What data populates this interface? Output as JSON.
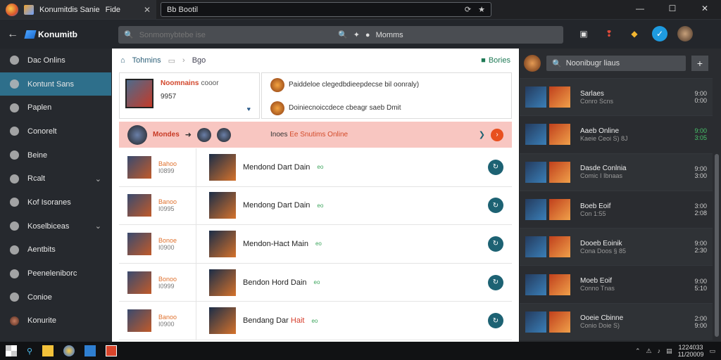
{
  "browser": {
    "tab_title": "Konumitdis Sanie",
    "tab2_title": "Fide",
    "url": "Bb Bootil"
  },
  "app": {
    "logo": "Konumitb",
    "search_placeholder": "Sonmomybtebe ise",
    "search_mid": "Momms"
  },
  "sidebar": {
    "items": [
      {
        "label": "Dac Onlins"
      },
      {
        "label": "Kontunt Sans"
      },
      {
        "label": "Paplen"
      },
      {
        "label": "Conorelt"
      },
      {
        "label": "Beine"
      },
      {
        "label": "Rcalt"
      },
      {
        "label": "Kof Isoranes"
      },
      {
        "label": "Koselbiceas"
      },
      {
        "label": "Aentbits"
      },
      {
        "label": "Peeneleniborc"
      },
      {
        "label": "Conioe"
      },
      {
        "label": "Konurite"
      }
    ]
  },
  "main": {
    "crumb_root": "Tohmins",
    "crumb_child": "Bgo",
    "crumb_right": "Bories",
    "card": {
      "name": "Noomnains",
      "sub": "cooor",
      "count": "9957"
    },
    "notices": [
      {
        "text": "Paiddeloe clegedbdieepdecse bil oonraly)"
      },
      {
        "text": "Doiniecnoiccdece cbeagr saeb Dmit"
      }
    ],
    "banner": {
      "name": "Mondes",
      "text_a": "Inoes",
      "text_b": "Ee Snutims Online"
    },
    "rows": [
      {
        "l1": "Bahoo",
        "l2": "I0899",
        "title": "Mendond Dart Dain",
        "red": "",
        "tag": "eo"
      },
      {
        "l1": "Banoo",
        "l2": "I0995",
        "title": "Mendong Dart Dain",
        "red": "",
        "tag": "eo"
      },
      {
        "l1": "Bonoe",
        "l2": "I0900",
        "title": "Mendon-Hact Main",
        "red": "",
        "tag": "eo"
      },
      {
        "l1": "Bonoo",
        "l2": "I0999",
        "title": "Bendon Hord Dain",
        "red": "",
        "tag": "eo"
      },
      {
        "l1": "Banoo",
        "l2": "I0900",
        "title": "Bendang Dar ",
        "red": "Hait",
        "tag": "eo"
      }
    ]
  },
  "right_panel": {
    "search": "Noonibugr liaus",
    "items": [
      {
        "name": "Sarlaes",
        "sub": "Conro Scns",
        "val1": "9:00",
        "val2": "0:00",
        "green": false
      },
      {
        "name": "Aaeb Online",
        "sub": "Kaeie Ceoi S) 8J",
        "val1": "9:00",
        "val2": "3:05",
        "green": true
      },
      {
        "name": "Dasde Conlnia",
        "sub": "Comic I Ibnaas",
        "val1": "9:00",
        "val2": "3:00",
        "green": false
      },
      {
        "name": "Boeb Eoif",
        "sub": "Con 1:55",
        "val1": "3:00",
        "val2": "2:08",
        "green": false
      },
      {
        "name": "Dooeb Eoinik",
        "sub": "Cona Doos § 85",
        "val1": "9:00",
        "val2": "2:30",
        "green": false
      },
      {
        "name": "Moeb Eoif",
        "sub": "Conno Tnas",
        "val1": "9:00",
        "val2": "5:10",
        "green": false
      },
      {
        "name": "Ooeie Cbinne",
        "sub": "Conio Doie S)",
        "val1": "2:00",
        "val2": "9:00",
        "green": false
      }
    ]
  },
  "taskbar": {
    "time": "1224033",
    "date": "11/20009"
  }
}
